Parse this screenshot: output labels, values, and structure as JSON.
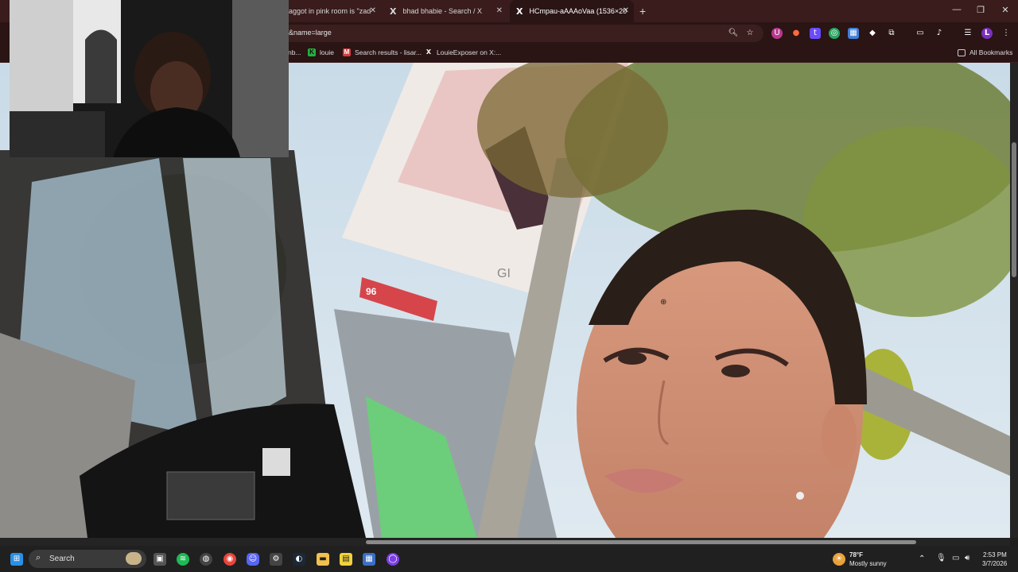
{
  "browser": {
    "tabs": [
      {
        "label": "aggot in pink room is \"zad",
        "active": false
      },
      {
        "label": "bhad bhabie - Search / X",
        "active": false
      },
      {
        "label": "HCmpau-aAAAoVaa (1536×20",
        "active": true
      }
    ],
    "new_tab_label": "+",
    "url": "&name=large",
    "profile_initial": "L",
    "bookmarks": [
      {
        "label": "nb..."
      },
      {
        "label": "louie"
      },
      {
        "label": "Search results - lisar..."
      },
      {
        "label": "LouieExposer on X:..."
      }
    ],
    "all_bookmarks_label": "All Bookmarks"
  },
  "taskbar": {
    "search_label": "Search",
    "weather_temp": "78°F",
    "weather_desc": "Mostly sunny",
    "time": "2:53 PM",
    "date": "3/7/2026"
  },
  "content": {
    "billboard_text": "GI",
    "sign_text": "96"
  },
  "colors": {
    "tab_strip": "#3a1c1c",
    "toolbar": "#2a1414",
    "taskbar": "#202020",
    "profile_badge": "#7b2fbe"
  }
}
